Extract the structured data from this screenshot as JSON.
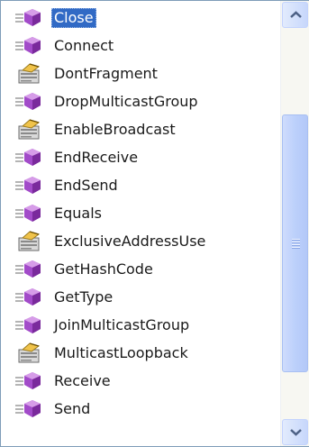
{
  "list": {
    "selected_index": 0,
    "items": [
      {
        "label": "Close",
        "icon": "method-icon"
      },
      {
        "label": "Connect",
        "icon": "method-icon"
      },
      {
        "label": "DontFragment",
        "icon": "property-icon"
      },
      {
        "label": "DropMulticastGroup",
        "icon": "method-icon"
      },
      {
        "label": "EnableBroadcast",
        "icon": "property-icon"
      },
      {
        "label": "EndReceive",
        "icon": "method-icon"
      },
      {
        "label": "EndSend",
        "icon": "method-icon"
      },
      {
        "label": "Equals",
        "icon": "method-icon"
      },
      {
        "label": "ExclusiveAddressUse",
        "icon": "property-icon"
      },
      {
        "label": "GetHashCode",
        "icon": "method-icon"
      },
      {
        "label": "GetType",
        "icon": "method-icon"
      },
      {
        "label": "JoinMulticastGroup",
        "icon": "method-icon"
      },
      {
        "label": "MulticastLoopback",
        "icon": "property-icon"
      },
      {
        "label": "Receive",
        "icon": "method-icon"
      },
      {
        "label": "Send",
        "icon": "method-icon"
      }
    ]
  },
  "scrollbar": {
    "up_icon": "chevron-up-icon",
    "down_icon": "chevron-down-icon"
  },
  "colors": {
    "selection": "#316ac5",
    "method_icon": "#a24bc9",
    "property_icon": "#8b8b8b",
    "scroll_arrow": "#4d6185"
  }
}
